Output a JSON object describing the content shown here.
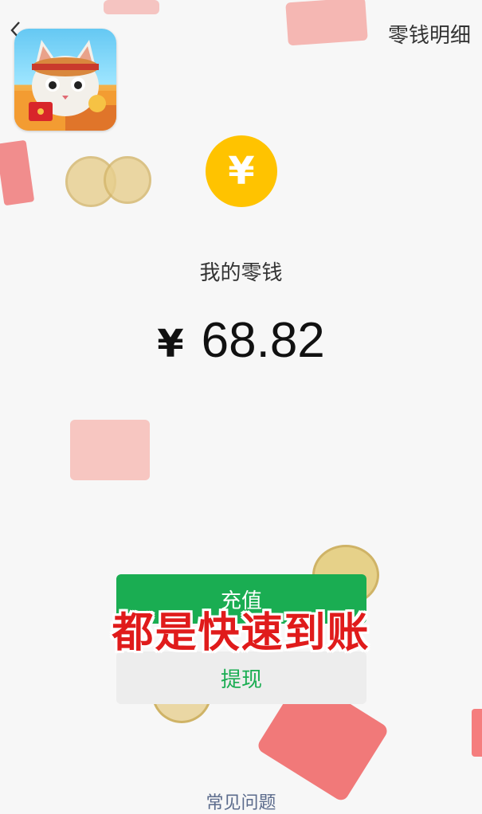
{
  "header": {
    "back_label": "‹",
    "title": "零钱明细"
  },
  "wallet": {
    "coin_symbol": "¥",
    "label": "我的零钱",
    "currency_symbol": "¥",
    "amount": "68.82"
  },
  "actions": {
    "recharge_label": "充值",
    "withdraw_label": "提现"
  },
  "overlay": {
    "caption": "都是快速到账"
  },
  "footer": {
    "faq_label": "常见问题"
  },
  "colors": {
    "accent_green": "#1aad52",
    "coin_yellow": "#ffc300",
    "caption_red": "#e01b1b"
  }
}
